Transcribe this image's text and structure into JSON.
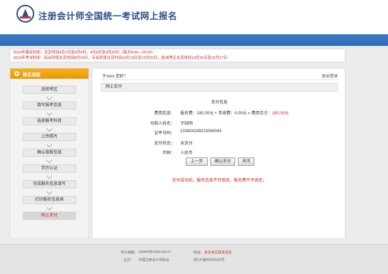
{
  "header": {
    "title": "注册会计师全国统一考试网上报名"
  },
  "notice": {
    "line1": "2019年报名时间：北京时间4月1日至4月4日、4月8日至4月30日（每天8:00—20:00）",
    "line2": "2019年考试时间：综合阶段北京时间8月24日，专业阶段北京时间10月19日至10月20日，欧洲考区北京时间10月26日至10月27日"
  },
  "sidebar": {
    "heading": "报名流程",
    "steps": [
      {
        "label": "选择考区"
      },
      {
        "label": "填写报考信息"
      },
      {
        "label": "选择报考科目"
      },
      {
        "label": "上传照片"
      },
      {
        "label": "确认填报信息"
      },
      {
        "label": "学历认证"
      },
      {
        "label": "完成报名信息填写"
      },
      {
        "label": "打印报名信息表"
      },
      {
        "label": "网上支付"
      }
    ]
  },
  "main": {
    "greeting": "于xxxx 您好！",
    "logout": "退出登录",
    "section": "网上支付",
    "pay_title": "支付信息",
    "fee": {
      "label": "费用信息：",
      "value": "报名费：180.00元 + 手续费：0.00元 = 费用合计：",
      "total": "180.00元"
    },
    "payer": {
      "label": "付款人姓名：",
      "value": "于晓明"
    },
    "id_number": {
      "label": "证件号码：",
      "value": "210804199210060044"
    },
    "status": {
      "label": "支付状态：",
      "value": "未支付"
    },
    "currency": {
      "label": "币种：",
      "value": "人民币"
    },
    "buttons": {
      "prev": "上一步",
      "confirm": "确认支付",
      "close": "关闭"
    },
    "hint": "支付成功后，报名信息不可修改，报名费不予退还。"
  },
  "footer": {
    "email_label": "电子邮箱：",
    "email": "cpabm@cicpa.org.cn",
    "phone_label": "电话：",
    "phone": "各省考区联系信息",
    "sponsor_label": "主办：",
    "sponsor": "中国注册会计师协会",
    "icp": "京ICP备05034320号"
  },
  "colors": {
    "brand_blue": "#2d4e8b",
    "band_blue": "#3f7cc7",
    "sidebar_orange": "#f0a310",
    "alert_red": "#d21f1f"
  }
}
